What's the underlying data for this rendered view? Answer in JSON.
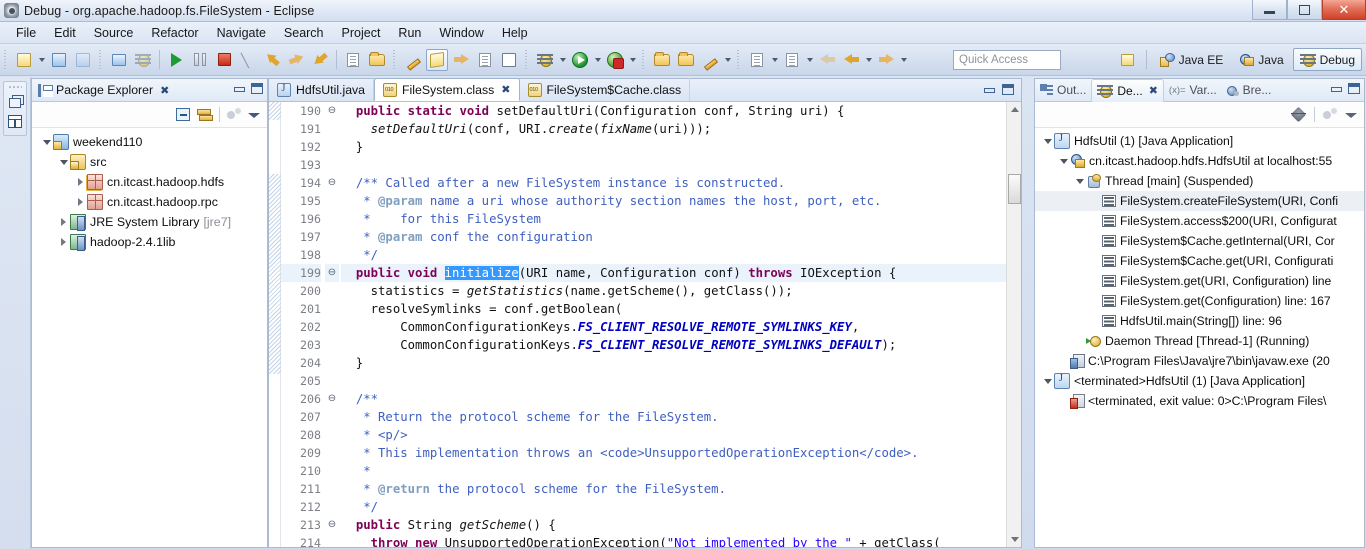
{
  "window": {
    "title": "Debug - org.apache.hadoop.fs.FileSystem - Eclipse",
    "app_icon": "eclipse-icon",
    "minimize": "–",
    "maximize": "❐",
    "close": "✕"
  },
  "menu": [
    "File",
    "Edit",
    "Source",
    "Refactor",
    "Navigate",
    "Search",
    "Project",
    "Run",
    "Window",
    "Help"
  ],
  "toolbar": {
    "quick_access_placeholder": "Quick Access",
    "perspectives": [
      {
        "label": "Java EE",
        "icon": "java-ee-perspective-icon",
        "active": false
      },
      {
        "label": "Java",
        "icon": "java-perspective-icon",
        "active": false
      },
      {
        "label": "Debug",
        "icon": "debug-perspective-icon",
        "active": true
      }
    ],
    "open_perspective_icon": "open-perspective-icon"
  },
  "package_explorer": {
    "title": "Package Explorer",
    "close_glyph": "✖",
    "tree": [
      {
        "label": "weekend110",
        "indent": 0,
        "twisty": "open",
        "icon": "project-icon"
      },
      {
        "label": "src",
        "indent": 1,
        "twisty": "open",
        "icon": "source-folder-icon"
      },
      {
        "label": "cn.itcast.hadoop.hdfs",
        "indent": 2,
        "twisty": "closed",
        "icon": "package-icon"
      },
      {
        "label": "cn.itcast.hadoop.rpc",
        "indent": 2,
        "twisty": "closed",
        "icon": "package-icon"
      },
      {
        "label": "JRE System Library",
        "indent": 1,
        "twisty": "closed",
        "icon": "library-icon",
        "suffix": "[jre7]"
      },
      {
        "label": "hadoop-2.4.1lib",
        "indent": 1,
        "twisty": "closed",
        "icon": "library-icon"
      }
    ]
  },
  "editor": {
    "tabs": [
      {
        "label": "HdfsUtil.java",
        "icon": "java-file-icon",
        "active": false,
        "closable": false
      },
      {
        "label": "FileSystem.class",
        "icon": "class-file-icon",
        "active": true,
        "closable": true
      },
      {
        "label": "FileSystem$Cache.class",
        "icon": "class-file-icon",
        "active": false,
        "closable": false
      }
    ],
    "first_line": 190,
    "highlighted_line": 199,
    "selection_text": "initialize",
    "lines": [
      {
        "n": 190,
        "fold": "⊖",
        "html": "  <span class='kw'>public static void</span> setDefaultUri(Configuration conf, String uri) {"
      },
      {
        "n": 191,
        "fold": "",
        "html": "    <span class='mth'>setDefaultUri</span>(conf, URI.<span class='mth'>create</span>(<span class='mth'>fixName</span>(uri)));"
      },
      {
        "n": 192,
        "fold": "",
        "html": "  }"
      },
      {
        "n": 193,
        "fold": "",
        "html": ""
      },
      {
        "n": 194,
        "fold": "⊖",
        "html": "  <span class='cmt-js'>/** Called after a new FileSystem instance is constructed.</span>"
      },
      {
        "n": 195,
        "fold": "",
        "html": "   <span class='cmt-js'>* </span><span class='cmt-tag'>@param</span><span class='cmt-js'> name a uri whose authority section names the host, port, etc.</span>"
      },
      {
        "n": 196,
        "fold": "",
        "html": "   <span class='cmt-js'>*    for this FileSystem</span>"
      },
      {
        "n": 197,
        "fold": "",
        "html": "   <span class='cmt-js'>* </span><span class='cmt-tag'>@param</span><span class='cmt-js'> conf the configuration</span>"
      },
      {
        "n": 198,
        "fold": "",
        "html": "   <span class='cmt-js'>*/</span>"
      },
      {
        "n": 199,
        "fold": "⊖",
        "html": "  <span class='kw'>public void</span> <span class='sel'>initialize</span>(URI name, Configuration conf) <span class='kw'>throws</span> IOException {"
      },
      {
        "n": 200,
        "fold": "",
        "html": "    statistics = <span class='mth'>getStatistics</span>(name.getScheme(), getClass());"
      },
      {
        "n": 201,
        "fold": "",
        "html": "    resolveSymlinks = conf.getBoolean("
      },
      {
        "n": 202,
        "fold": "",
        "html": "        CommonConfigurationKeys.<span class='fld'>FS_CLIENT_RESOLVE_REMOTE_SYMLINKS_KEY</span>,"
      },
      {
        "n": 203,
        "fold": "",
        "html": "        CommonConfigurationKeys.<span class='fld'>FS_CLIENT_RESOLVE_REMOTE_SYMLINKS_DEFAULT</span>);"
      },
      {
        "n": 204,
        "fold": "",
        "html": "  }"
      },
      {
        "n": 205,
        "fold": "",
        "html": ""
      },
      {
        "n": 206,
        "fold": "⊖",
        "html": "  <span class='cmt-js'>/**</span>"
      },
      {
        "n": 207,
        "fold": "",
        "html": "   <span class='cmt-js'>* Return the protocol scheme for the FileSystem.</span>"
      },
      {
        "n": 208,
        "fold": "",
        "html": "   <span class='cmt-js'>* &lt;p/&gt;</span>"
      },
      {
        "n": 209,
        "fold": "",
        "html": "   <span class='cmt-js'>* This implementation throws an &lt;code&gt;UnsupportedOperationException&lt;/code&gt;.</span>"
      },
      {
        "n": 210,
        "fold": "",
        "html": "   <span class='cmt-js'>*</span>"
      },
      {
        "n": 211,
        "fold": "",
        "html": "   <span class='cmt-js'>* </span><span class='cmt-tag'>@return</span><span class='cmt-js'> the protocol scheme for the FileSystem.</span>"
      },
      {
        "n": 212,
        "fold": "",
        "html": "   <span class='cmt-js'>*/</span>"
      },
      {
        "n": 213,
        "fold": "⊖",
        "html": "  <span class='kw'>public</span> String <span class='mth'>getScheme</span>() {"
      },
      {
        "n": 214,
        "fold": "",
        "html": "    <span class='kw'>throw new</span> UnsupportedOperationException(<span class='str'>\"Not implemented by the \"</span> + getClass("
      }
    ]
  },
  "debug_panel": {
    "tabs": [
      {
        "label": "Out...",
        "icon": "outline-icon",
        "active": false,
        "closable": false
      },
      {
        "label": "De...",
        "icon": "debug-icon",
        "active": true,
        "closable": true
      },
      {
        "label": "Var...",
        "icon": "variables-icon",
        "active": false,
        "closable": false
      },
      {
        "label": "Bre...",
        "icon": "breakpoints-icon",
        "active": false,
        "closable": false
      }
    ],
    "tree": [
      {
        "label": "HdfsUtil (1) [Java Application]",
        "indent": 0,
        "twisty": "open",
        "icon": "launch-icon"
      },
      {
        "label": "cn.itcast.hadoop.hdfs.HdfsUtil at localhost:55",
        "indent": 1,
        "twisty": "open",
        "icon": "debug-target-icon"
      },
      {
        "label": "Thread [main] (Suspended)",
        "indent": 2,
        "twisty": "open",
        "icon": "thread-suspended-icon"
      },
      {
        "label": "FileSystem.createFileSystem(URI, Confi",
        "indent": 3,
        "twisty": "none",
        "icon": "stack-frame-icon",
        "selected": true
      },
      {
        "label": "FileSystem.access$200(URI, Configurat",
        "indent": 3,
        "twisty": "none",
        "icon": "stack-frame-icon"
      },
      {
        "label": "FileSystem$Cache.getInternal(URI, Cor",
        "indent": 3,
        "twisty": "none",
        "icon": "stack-frame-icon"
      },
      {
        "label": "FileSystem$Cache.get(URI, Configurati",
        "indent": 3,
        "twisty": "none",
        "icon": "stack-frame-icon"
      },
      {
        "label": "FileSystem.get(URI, Configuration) line",
        "indent": 3,
        "twisty": "none",
        "icon": "stack-frame-icon"
      },
      {
        "label": "FileSystem.get(Configuration) line: 167",
        "indent": 3,
        "twisty": "none",
        "icon": "stack-frame-icon"
      },
      {
        "label": "HdfsUtil.main(String[]) line: 96",
        "indent": 3,
        "twisty": "none",
        "icon": "stack-frame-icon"
      },
      {
        "label": "Daemon Thread [Thread-1] (Running)",
        "indent": 2,
        "twisty": "none",
        "icon": "thread-running-icon"
      },
      {
        "label": "C:\\Program Files\\Java\\jre7\\bin\\javaw.exe (20",
        "indent": 1,
        "twisty": "none",
        "icon": "process-icon"
      },
      {
        "label": "<terminated>HdfsUtil (1) [Java Application]",
        "indent": 0,
        "twisty": "open",
        "icon": "launch-icon"
      },
      {
        "label": "<terminated, exit value: 0>C:\\Program Files\\",
        "indent": 1,
        "twisty": "none",
        "icon": "process-terminated-icon"
      }
    ]
  }
}
